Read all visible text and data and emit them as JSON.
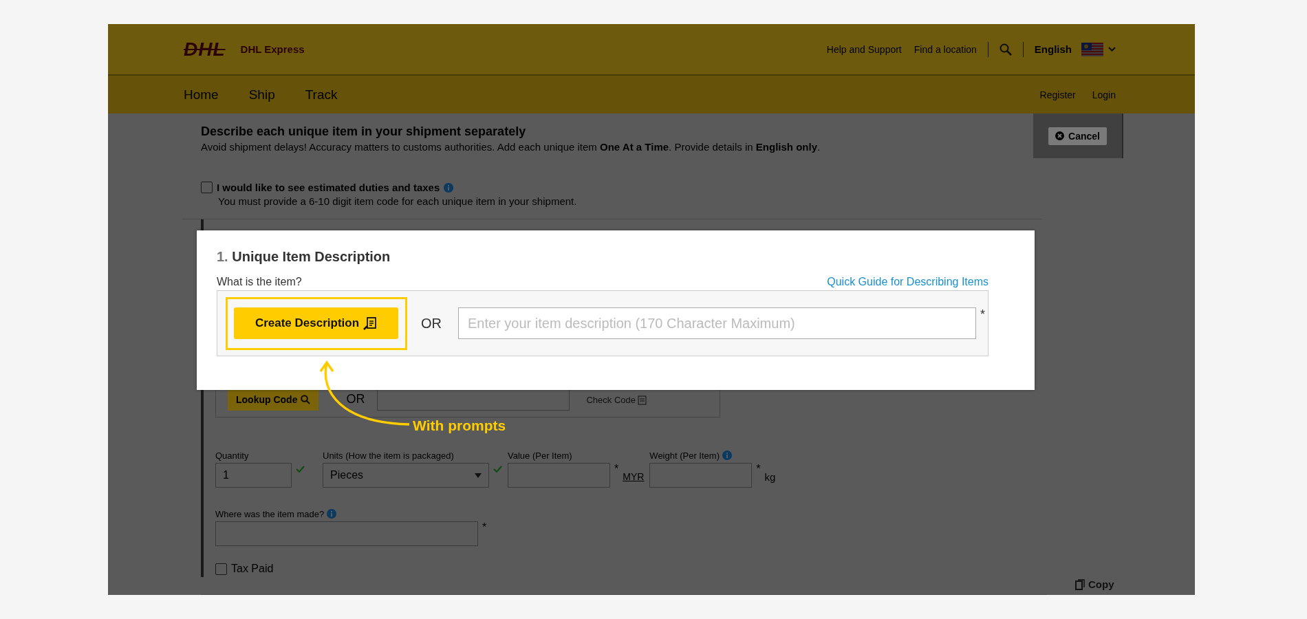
{
  "header": {
    "logo": "DHL",
    "brand": "DHL Express",
    "links": [
      "Help and Support",
      "Find a location"
    ],
    "language": "English"
  },
  "nav": {
    "items": [
      {
        "label": "Home"
      },
      {
        "label": "Ship"
      },
      {
        "label": "Track"
      }
    ],
    "account_links": [
      "Register",
      "Login"
    ]
  },
  "cancel_button": "Cancel",
  "intro": {
    "title": "Describe each unique item in your shipment separately",
    "text": "Avoid shipment delays! Accuracy matters to customs authorities.  Add each unique item **One At a Time**.  Provide details in **English only**."
  },
  "duties_option": {
    "label": "I would like to see estimated duties and taxes",
    "checked": false,
    "note": "You must provide a 6-10 digit item code for each unique item in your shipment."
  },
  "code_lookup": {
    "button": "Lookup Code",
    "separator": "OR",
    "check_label": "Check Code"
  },
  "fields": [
    {
      "kind": "text",
      "label": "Quantity",
      "value": "1",
      "valid": true
    },
    {
      "kind": "select",
      "label": "Units (How the item is packaged)",
      "value": "Pieces",
      "valid": true
    },
    {
      "kind": "text",
      "label": "Value (Per Item)",
      "required_mark": "*",
      "unit": {
        "text": "MYR",
        "link": true
      }
    },
    {
      "kind": "text",
      "label": "Weight (Per Item)",
      "info": true,
      "required_mark": "*",
      "unit": {
        "text": "kg",
        "link": false
      }
    }
  ],
  "origin": {
    "label": "Where was the item made?",
    "info": true,
    "required_mark": "*"
  },
  "tax_paid": {
    "label": "Tax Paid",
    "checked": false
  },
  "copy_action": "Copy",
  "modal": {
    "number": "1.",
    "title": "Unique Item Description",
    "question": "What is the item?",
    "guide_link": "Quick Guide for Describing Items",
    "button": "Create Description",
    "separator": "OR",
    "placeholder": "Enter your item description (170 Character Maximum)",
    "required_mark": "*"
  },
  "annotation": {
    "label": "With prompts"
  }
}
